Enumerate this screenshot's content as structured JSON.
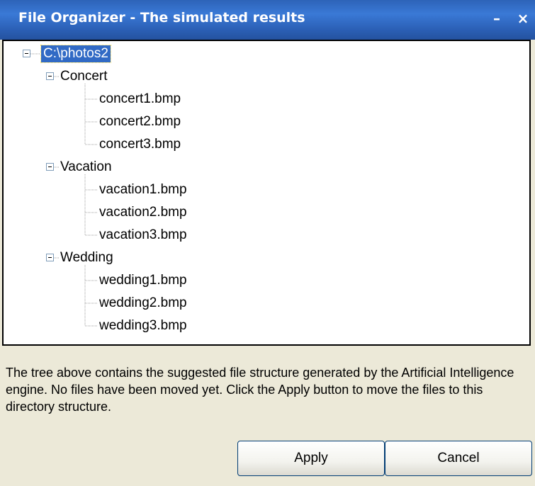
{
  "window": {
    "title": "File Organizer - The simulated results",
    "minimize_glyph": "–",
    "close_glyph": "×"
  },
  "tree": {
    "root": "C:\\photos2",
    "folders": [
      {
        "name": "Concert",
        "files": [
          "concert1.bmp",
          "concert2.bmp",
          "concert3.bmp"
        ]
      },
      {
        "name": "Vacation",
        "files": [
          "vacation1.bmp",
          "vacation2.bmp",
          "vacation3.bmp"
        ]
      },
      {
        "name": "Wedding",
        "files": [
          "wedding1.bmp",
          "wedding2.bmp",
          "wedding3.bmp"
        ]
      }
    ]
  },
  "description": "The tree above contains the suggested file structure generated by the Artificial Intelligence engine. No files have been moved yet. Click the Apply button to move the files to this directory structure.",
  "buttons": {
    "apply": "Apply",
    "cancel": "Cancel"
  }
}
